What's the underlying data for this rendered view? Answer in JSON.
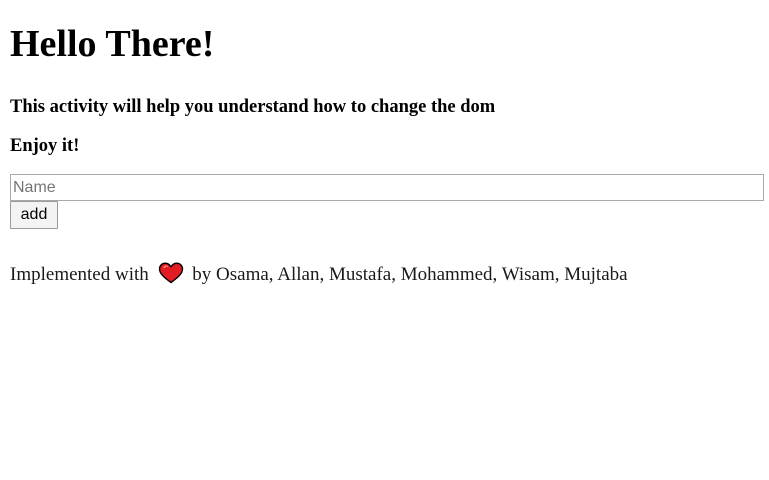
{
  "header": {
    "title": "Hello There!",
    "subtitle": "This activity will help you understand how to change the dom",
    "enjoy": "Enjoy it!"
  },
  "form": {
    "name_placeholder": "Name",
    "name_value": "",
    "add_label": "add"
  },
  "footer": {
    "prefix": "Implemented with",
    "icon": "heart-icon",
    "suffix": "by Osama, Allan, Mustafa, Mohammed, Wisam, Mujtaba"
  },
  "colors": {
    "heart": "#e31b23",
    "heart_outline": "#000000"
  }
}
